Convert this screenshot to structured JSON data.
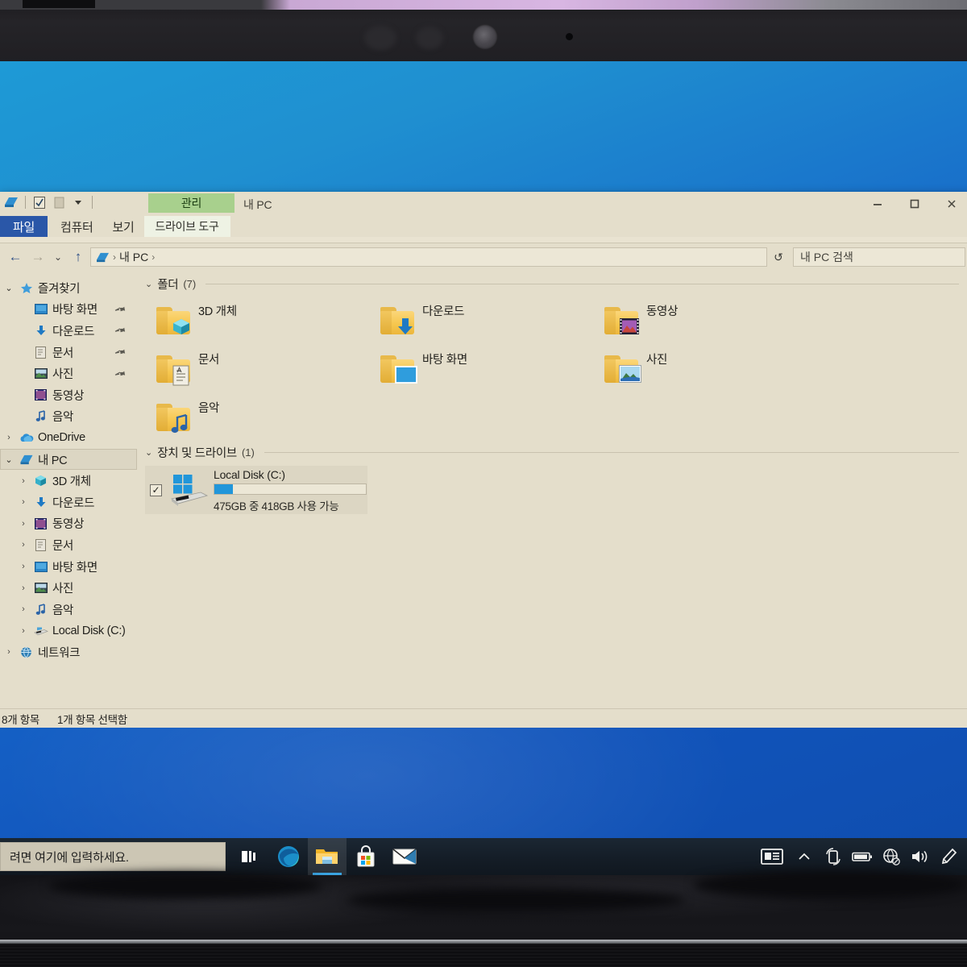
{
  "window": {
    "title": "내 PC",
    "contextual_tab_header": "관리",
    "quick_access": [
      "explorer-icon",
      "properties-icon",
      "new-folder-icon",
      "customize-chevron-icon"
    ],
    "controls": {
      "minimize": "—",
      "maximize": "□",
      "close": "✕"
    }
  },
  "ribbon": {
    "tabs": [
      {
        "label": "파일",
        "kind": "file"
      },
      {
        "label": "컴퓨터",
        "kind": "normal"
      },
      {
        "label": "보기",
        "kind": "normal"
      },
      {
        "label": "드라이브 도구",
        "kind": "contextual"
      }
    ]
  },
  "address": {
    "back_icon": "←",
    "forward_icon": "→",
    "recent_icon": "⌄",
    "up_icon": "↑",
    "breadcrumb": [
      "내 PC"
    ],
    "separator": "›",
    "refresh_icon": "↺",
    "search_placeholder": "내 PC 검색"
  },
  "sidebar": {
    "items": [
      {
        "label": "즐겨찾기",
        "level": 1,
        "chevron": "open",
        "icon": "star-icon",
        "pinned": false,
        "selected": false
      },
      {
        "label": "바탕 화면",
        "level": 2,
        "chevron": "none",
        "icon": "desktop-icon",
        "pinned": true,
        "selected": false
      },
      {
        "label": "다운로드",
        "level": 2,
        "chevron": "none",
        "icon": "download-icon",
        "pinned": true,
        "selected": false
      },
      {
        "label": "문서",
        "level": 2,
        "chevron": "none",
        "icon": "documents-icon",
        "pinned": true,
        "selected": false
      },
      {
        "label": "사진",
        "level": 2,
        "chevron": "none",
        "icon": "pictures-icon",
        "pinned": true,
        "selected": false
      },
      {
        "label": "동영상",
        "level": 2,
        "chevron": "none",
        "icon": "videos-icon",
        "pinned": false,
        "selected": false
      },
      {
        "label": "음악",
        "level": 2,
        "chevron": "none",
        "icon": "music-icon",
        "pinned": false,
        "selected": false
      },
      {
        "label": "OneDrive",
        "level": 1,
        "chevron": "closed",
        "icon": "onedrive-icon",
        "pinned": false,
        "selected": false
      },
      {
        "label": "내 PC",
        "level": 1,
        "chevron": "open",
        "icon": "this-pc-icon",
        "pinned": false,
        "selected": true
      },
      {
        "label": "3D 개체",
        "level": 2,
        "chevron": "closed",
        "icon": "3d-objects-icon",
        "pinned": false,
        "selected": false
      },
      {
        "label": "다운로드",
        "level": 2,
        "chevron": "closed",
        "icon": "download-icon",
        "pinned": false,
        "selected": false
      },
      {
        "label": "동영상",
        "level": 2,
        "chevron": "closed",
        "icon": "videos-icon",
        "pinned": false,
        "selected": false
      },
      {
        "label": "문서",
        "level": 2,
        "chevron": "closed",
        "icon": "documents-icon",
        "pinned": false,
        "selected": false
      },
      {
        "label": "바탕 화면",
        "level": 2,
        "chevron": "closed",
        "icon": "desktop-icon",
        "pinned": false,
        "selected": false
      },
      {
        "label": "사진",
        "level": 2,
        "chevron": "closed",
        "icon": "pictures-icon",
        "pinned": false,
        "selected": false
      },
      {
        "label": "음악",
        "level": 2,
        "chevron": "closed",
        "icon": "music-icon",
        "pinned": false,
        "selected": false
      },
      {
        "label": "Local Disk (C:)",
        "level": 2,
        "chevron": "closed",
        "icon": "drive-icon",
        "pinned": false,
        "selected": false
      },
      {
        "label": "네트워크",
        "level": 1,
        "chevron": "closed",
        "icon": "network-icon",
        "pinned": false,
        "selected": false
      }
    ]
  },
  "content": {
    "folders_group": {
      "chevron": "⌄",
      "title": "폴더",
      "count": "(7)"
    },
    "folders": [
      {
        "label": "3D 개체",
        "icon": "3d-object-overlay"
      },
      {
        "label": "다운로드",
        "icon": "download-arrow-overlay"
      },
      {
        "label": "동영상",
        "icon": "film-strip-overlay"
      },
      {
        "label": "문서",
        "icon": "document-overlay"
      },
      {
        "label": "바탕 화면",
        "icon": "desktop-overlay"
      },
      {
        "label": "사진",
        "icon": "photo-overlay"
      },
      {
        "label": "음악",
        "icon": "music-note-overlay"
      }
    ],
    "drives_group": {
      "chevron": "⌄",
      "title": "장치 및 드라이브",
      "count": "(1)"
    },
    "drives": [
      {
        "name": "Local Disk (C:)",
        "free_text": "475GB 중 418GB 사용 가능",
        "used_percent": 12,
        "selected": true,
        "checkbox": "✓"
      }
    ]
  },
  "statusbar": {
    "item_count": "8개 항목",
    "selection": "1개 항목 선택함"
  },
  "taskbar": {
    "search_text": "려면 여기에 입력하세요.",
    "buttons": [
      {
        "name": "task-view-icon",
        "active": false
      },
      {
        "name": "edge-icon",
        "active": false
      },
      {
        "name": "file-explorer-icon",
        "active": true
      },
      {
        "name": "microsoft-store-icon",
        "active": false
      },
      {
        "name": "mail-icon",
        "active": false
      }
    ],
    "tray": [
      {
        "name": "news-and-interests-icon"
      },
      {
        "name": "show-hidden-icons-chevron"
      },
      {
        "name": "rotation-lock-icon"
      },
      {
        "name": "battery-icon"
      },
      {
        "name": "network-disconnected-icon"
      },
      {
        "name": "volume-icon"
      },
      {
        "name": "pen-menu-icon"
      }
    ]
  },
  "colors": {
    "window_bg": "#e4decb",
    "file_tab": "#2a57a8",
    "contextual_green": "#a8d08d",
    "selection": "#dcd6c3",
    "accent_blue": "#2196da",
    "wallpaper_blue": "#1664c8"
  }
}
